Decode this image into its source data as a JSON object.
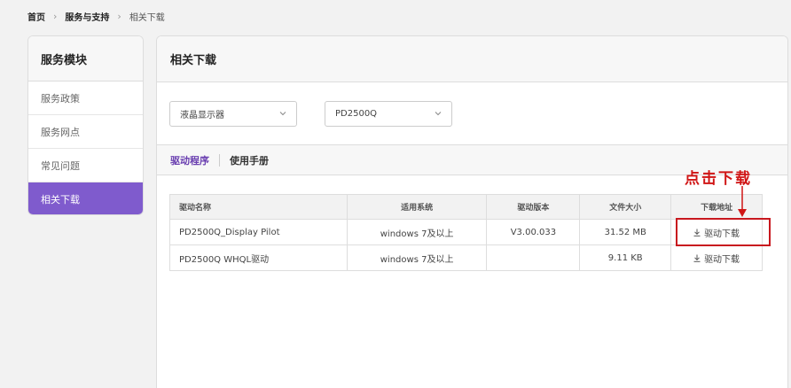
{
  "breadcrumb": {
    "home": "首页",
    "service": "服务与支持",
    "current": "相关下载"
  },
  "sidebar": {
    "title": "服务模块",
    "items": [
      {
        "label": "服务政策"
      },
      {
        "label": "服务网点"
      },
      {
        "label": "常见问题"
      },
      {
        "label": "相关下载"
      }
    ]
  },
  "main": {
    "title": "相关下载",
    "select_category": "液晶显示器",
    "select_product": "PD2500Q",
    "tabs": [
      {
        "label": "驱动程序"
      },
      {
        "label": "使用手册"
      }
    ],
    "table": {
      "headers": [
        "驱动名称",
        "适用系统",
        "驱动版本",
        "文件大小",
        "下载地址"
      ],
      "rows": [
        {
          "name": "PD2500Q_Display Pilot",
          "os": "windows 7及以上",
          "version": "V3.00.033",
          "size": "31.52 MB",
          "download": "驱动下载"
        },
        {
          "name": "PD2500Q WHQL驱动",
          "os": "windows 7及以上",
          "version": "",
          "size": "9.11 KB",
          "download": "驱动下载"
        }
      ]
    }
  },
  "annotation": {
    "text": "点击下载",
    "color": "#d01515"
  },
  "colors": {
    "accent": "#7f5bcd",
    "tab_active": "#6a3fb0",
    "highlight": "#c8181e"
  }
}
